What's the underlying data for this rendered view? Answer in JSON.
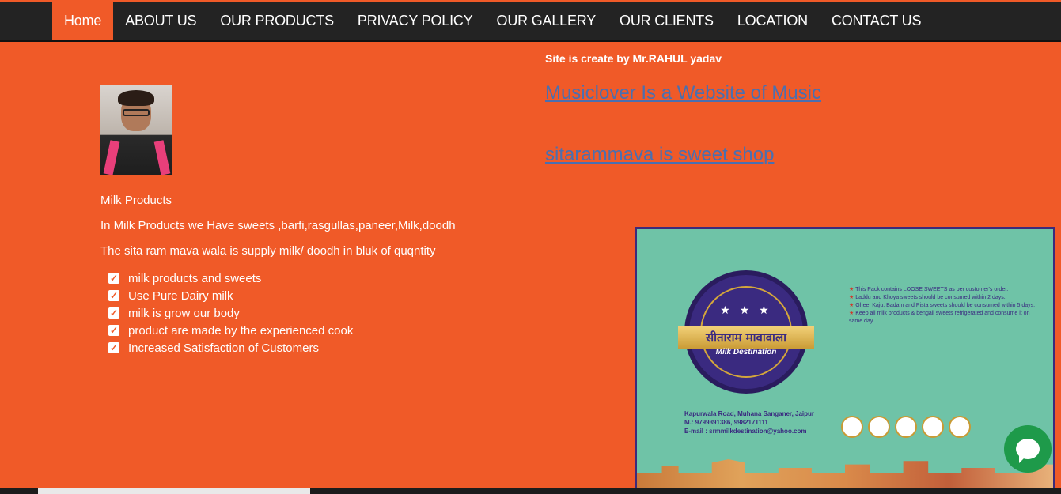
{
  "nav": {
    "items": [
      {
        "label": "Home",
        "active": true
      },
      {
        "label": "ABOUT US"
      },
      {
        "label": "OUR PRODUCTS"
      },
      {
        "label": "PRIVACY POLICY"
      },
      {
        "label": "OUR GALLERY"
      },
      {
        "label": "OUR CLIENTS"
      },
      {
        "label": "LOCATION"
      },
      {
        "label": "CONTACT US"
      }
    ]
  },
  "credit": "Site is create by Mr.RAHUL yadav",
  "links": {
    "musiclover": "Musiclover Is a Website of Music",
    "sitaram": "sitarammava is sweet shop"
  },
  "content": {
    "heading": "Milk Products",
    "line1": "In Milk Products we Have sweets ,barfi,rasgullas,paneer,Milk,doodh",
    "line2": "The sita ram mava wala is supply milk/ doodh in bluk of quqntity",
    "checklist": [
      "milk products and sweets",
      "Use Pure Dairy milk",
      "milk is grow our body",
      "product are made by the experienced cook",
      "Increased Satisfaction of Customers"
    ]
  },
  "poster": {
    "brand": "सीताराम मावावाला",
    "subtitle": "Milk Destination",
    "notes": [
      "This Pack contains LOOSE SWEETS as per customer's order.",
      "Laddu and Khoya sweets should be consumed within 2 days.",
      "Ghee, Kaju, Badam and Pista sweets should be consumed within 5 days.",
      "Keep all milk products & bengali sweets refrigerated and consume it on same day."
    ],
    "address": [
      "Kapurwala Road, Muhana Sanganer, Jaipur",
      "M.: 9799391386, 9982171111",
      "E-mail : srmmilkdestination@yahoo.com"
    ]
  },
  "colors": {
    "page_bg": "#f05a28",
    "nav_bg": "#232323",
    "link": "#4a6fb0",
    "chat": "#1e9a4a"
  },
  "icons": {
    "check": "checkbox-checked-icon",
    "chat": "chat-bubble-icon"
  }
}
